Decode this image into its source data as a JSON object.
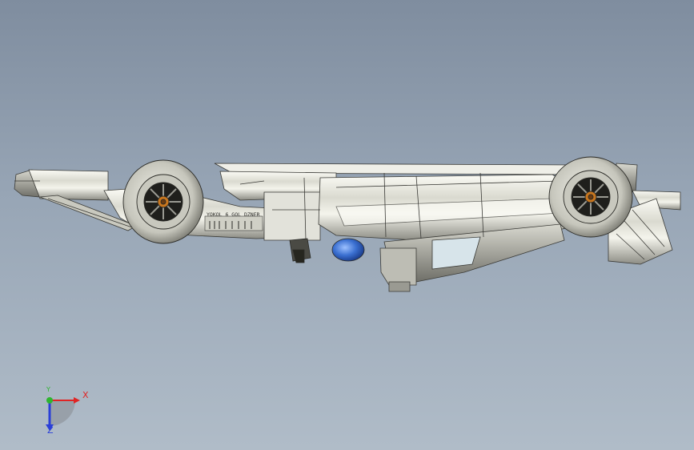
{
  "viewport": {
    "background_top": "#7f8d9f",
    "background_bottom": "#b0bcc8"
  },
  "model": {
    "name_icon": "race-car-side-view",
    "side_text": "YOKOL 6 GOL DZNER",
    "body_color": "#e6e6dc",
    "edge_color": "#3a3a36",
    "accent_color": "#c8761e",
    "blue_part_color": "#3a6fd0"
  },
  "triad": {
    "x_label": "X",
    "y_label": "Y",
    "z_label": "Z",
    "x_color": "#e02424",
    "y_color": "#2fb52f",
    "z_color": "#2a3fd8"
  }
}
